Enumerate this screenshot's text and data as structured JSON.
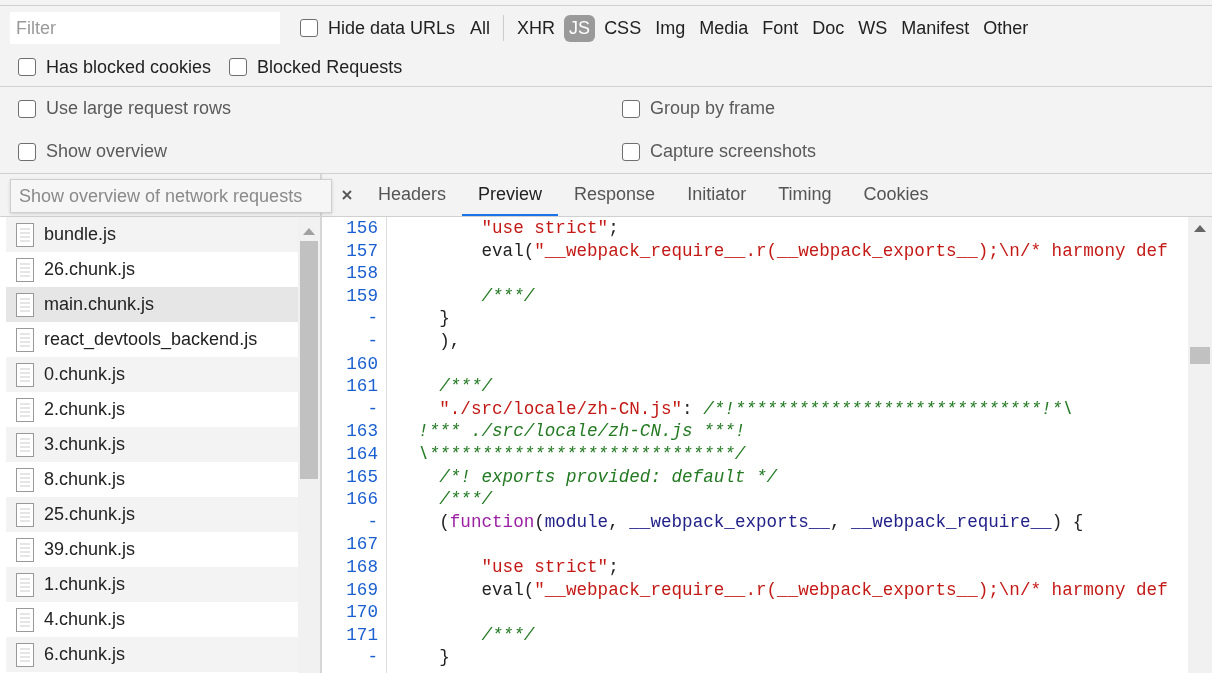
{
  "filter_bar": {
    "filter": {
      "placeholder": "Filter"
    },
    "hide_data_urls": {
      "label": "Hide data URLs",
      "checked": false
    },
    "types": [
      {
        "label": "All",
        "selected": false
      },
      {
        "label": "XHR",
        "selected": false
      },
      {
        "label": "JS",
        "selected": true
      },
      {
        "label": "CSS",
        "selected": false
      },
      {
        "label": "Img",
        "selected": false
      },
      {
        "label": "Media",
        "selected": false
      },
      {
        "label": "Font",
        "selected": false
      },
      {
        "label": "Doc",
        "selected": false
      },
      {
        "label": "WS",
        "selected": false
      },
      {
        "label": "Manifest",
        "selected": false
      },
      {
        "label": "Other",
        "selected": false
      }
    ],
    "options": [
      {
        "label": "Has blocked cookies",
        "checked": false
      },
      {
        "label": "Blocked Requests",
        "checked": false
      }
    ]
  },
  "settings": [
    {
      "label": "Use large request rows",
      "checked": false
    },
    {
      "label": "Group by frame",
      "checked": false
    },
    {
      "label": "Show overview",
      "checked": false
    },
    {
      "label": "Capture screenshots",
      "checked": false
    }
  ],
  "request_list": {
    "tooltip": "Show overview of network requests",
    "rows": [
      {
        "name": "bundle.js",
        "selected": false
      },
      {
        "name": "26.chunk.js",
        "selected": false
      },
      {
        "name": "main.chunk.js",
        "selected": true
      },
      {
        "name": "react_devtools_backend.js",
        "selected": false
      },
      {
        "name": "0.chunk.js",
        "selected": false
      },
      {
        "name": "2.chunk.js",
        "selected": false
      },
      {
        "name": "3.chunk.js",
        "selected": false
      },
      {
        "name": "8.chunk.js",
        "selected": false
      },
      {
        "name": "25.chunk.js",
        "selected": false
      },
      {
        "name": "39.chunk.js",
        "selected": false
      },
      {
        "name": "1.chunk.js",
        "selected": false
      },
      {
        "name": "4.chunk.js",
        "selected": false
      },
      {
        "name": "6.chunk.js",
        "selected": false
      }
    ]
  },
  "detail_tabs": [
    {
      "label": "Headers",
      "selected": false
    },
    {
      "label": "Preview",
      "selected": true
    },
    {
      "label": "Response",
      "selected": false
    },
    {
      "label": "Initiator",
      "selected": false
    },
    {
      "label": "Timing",
      "selected": false
    },
    {
      "label": "Cookies",
      "selected": false
    }
  ],
  "preview": {
    "lines": [
      {
        "number": "156",
        "kind": "deep",
        "tokens": [
          {
            "kind": "string",
            "text": "\"use strict\""
          },
          {
            "kind": "plain",
            "text": ";"
          }
        ]
      },
      {
        "number": "157",
        "kind": "deep",
        "tokens": [
          {
            "kind": "plain",
            "text": "eval("
          },
          {
            "kind": "string",
            "text": "\"__webpack_require__.r(__webpack_exports__);\\n/* harmony def"
          }
        ]
      },
      {
        "number": "158"
      },
      {
        "number": "159",
        "kind": "deep",
        "tokens": [
          {
            "kind": "comment",
            "text": "/***/"
          }
        ]
      },
      {
        "number": "-",
        "kind": "medium",
        "tokens": [
          {
            "kind": "plain",
            "text": "}"
          }
        ]
      },
      {
        "number": "-",
        "kind": "medium",
        "tokens": [
          {
            "kind": "plain",
            "text": "),"
          }
        ]
      },
      {
        "number": "160"
      },
      {
        "number": "161",
        "kind": "medium",
        "tokens": [
          {
            "kind": "comment",
            "text": "/***/"
          }
        ]
      },
      {
        "number": "-",
        "kind": "medium",
        "tokens": [
          {
            "kind": "string",
            "text": "\"./src/locale/zh-CN.js\""
          },
          {
            "kind": "plain",
            "text": ": "
          },
          {
            "kind": "comment",
            "text": "/*!*****************************!*\\"
          }
        ]
      },
      {
        "number": "163",
        "kind": "shallow",
        "tokens": [
          {
            "kind": "comment",
            "text": "!*** ./src/locale/zh-CN.js ***!"
          }
        ]
      },
      {
        "number": "164",
        "kind": "shallow",
        "tokens": [
          {
            "kind": "comment",
            "text": "\\*****************************/"
          }
        ]
      },
      {
        "number": "165",
        "kind": "medium",
        "tokens": [
          {
            "kind": "comment",
            "text": "/*! exports provided: default */"
          }
        ]
      },
      {
        "number": "166",
        "kind": "medium",
        "tokens": [
          {
            "kind": "comment",
            "text": "/***/"
          }
        ]
      },
      {
        "number": "-",
        "kind": "medium",
        "tokens": [
          {
            "kind": "plain",
            "text": "("
          },
          {
            "kind": "keyword",
            "text": "function"
          },
          {
            "kind": "plain",
            "text": "("
          },
          {
            "kind": "variable",
            "text": "module"
          },
          {
            "kind": "plain",
            "text": ", "
          },
          {
            "kind": "variable",
            "text": "__webpack_exports__"
          },
          {
            "kind": "plain",
            "text": ", "
          },
          {
            "kind": "variable",
            "text": "__webpack_require__"
          },
          {
            "kind": "plain",
            "text": ") {"
          }
        ]
      },
      {
        "number": "167"
      },
      {
        "number": "168",
        "kind": "deep",
        "tokens": [
          {
            "kind": "string",
            "text": "\"use strict\""
          },
          {
            "kind": "plain",
            "text": ";"
          }
        ]
      },
      {
        "number": "169",
        "kind": "deep",
        "tokens": [
          {
            "kind": "plain",
            "text": "eval("
          },
          {
            "kind": "string",
            "text": "\"__webpack_require__.r(__webpack_exports__);\\n/* harmony def"
          }
        ]
      },
      {
        "number": "170"
      },
      {
        "number": "171",
        "kind": "deep",
        "tokens": [
          {
            "kind": "comment",
            "text": "/***/"
          }
        ]
      },
      {
        "number": "-",
        "kind": "medium",
        "tokens": [
          {
            "kind": "plain",
            "text": "}"
          }
        ]
      }
    ]
  }
}
